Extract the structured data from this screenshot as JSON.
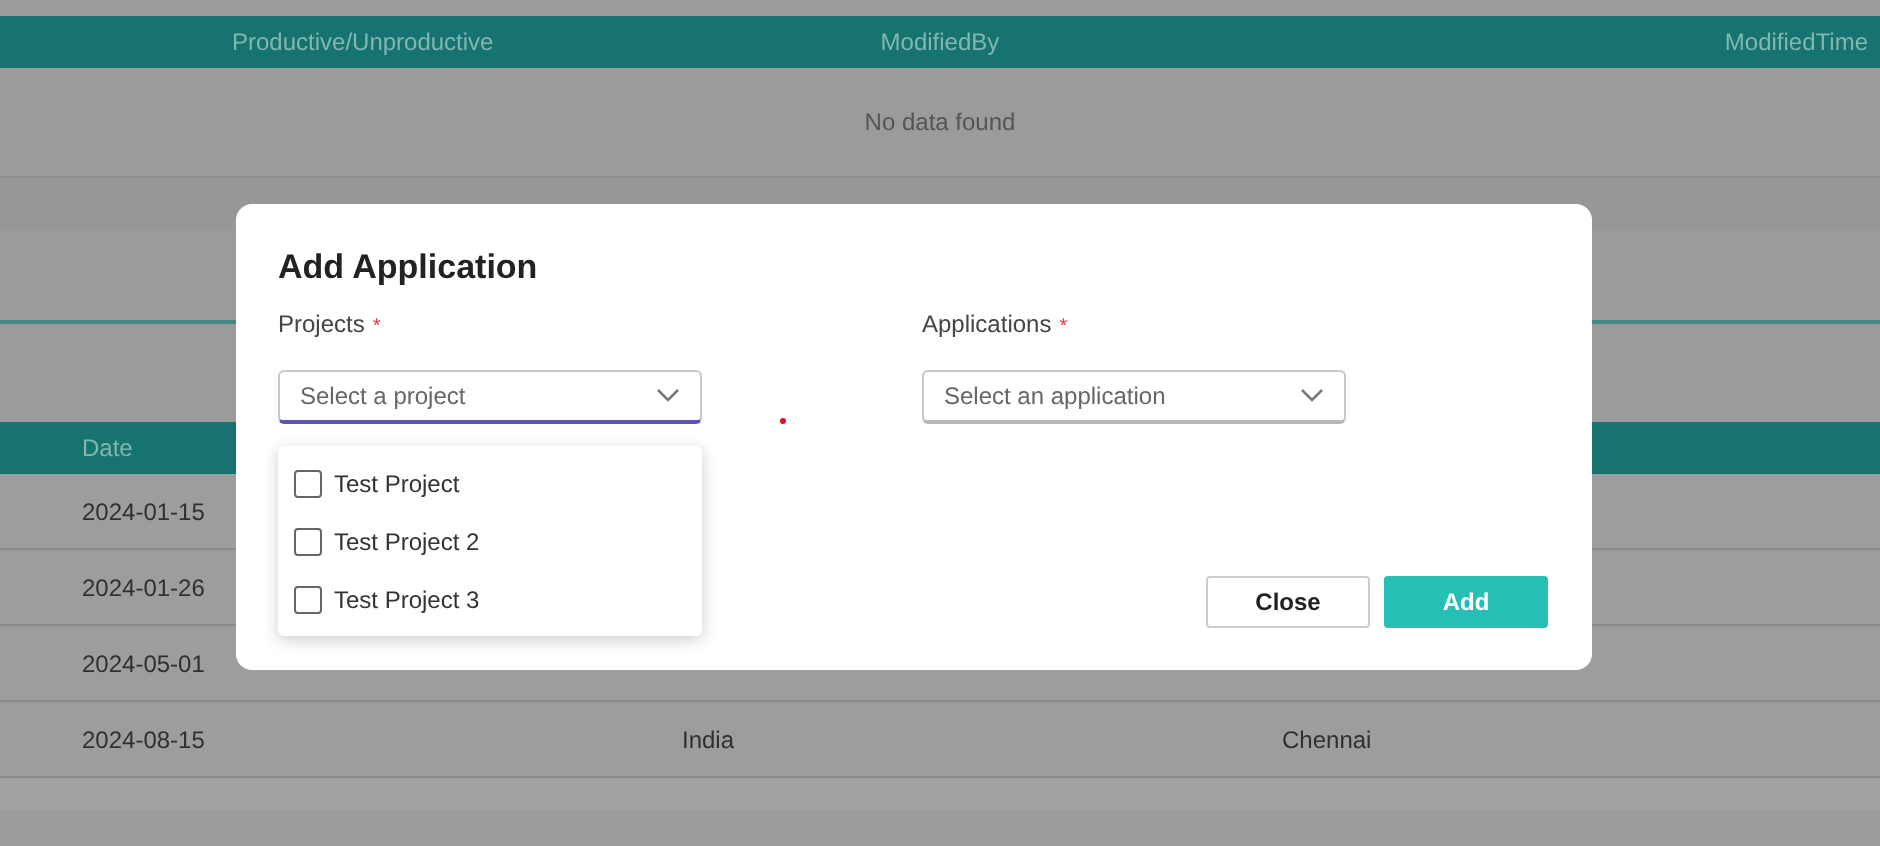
{
  "top_table": {
    "columns": [
      "Productive/Unproductive",
      "ModifiedBy",
      "ModifiedTime"
    ],
    "empty_message": "No data found"
  },
  "bottom_table": {
    "columns": [
      "Date"
    ],
    "rows": [
      {
        "cells": [
          "2024-01-15"
        ]
      },
      {
        "cells": [
          "2024-01-26"
        ]
      },
      {
        "cells": [
          "2024-05-01"
        ]
      },
      {
        "cells": [
          "2024-08-15",
          "India",
          "Chennai"
        ]
      }
    ]
  },
  "dialog": {
    "title": "Add Application",
    "fields": [
      {
        "label": "Projects",
        "required_mark": "*",
        "placeholder": "Select a project",
        "expanded": true,
        "options": [
          {
            "label": "Test Project",
            "checked": false
          },
          {
            "label": "Test Project 2",
            "checked": false
          },
          {
            "label": "Test Project 3",
            "checked": false
          }
        ]
      },
      {
        "label": "Applications",
        "required_mark": "*",
        "placeholder": "Select an application",
        "expanded": false
      }
    ],
    "buttons": [
      {
        "label": "Close",
        "kind": "secondary"
      },
      {
        "label": "Add",
        "kind": "primary"
      }
    ]
  }
}
